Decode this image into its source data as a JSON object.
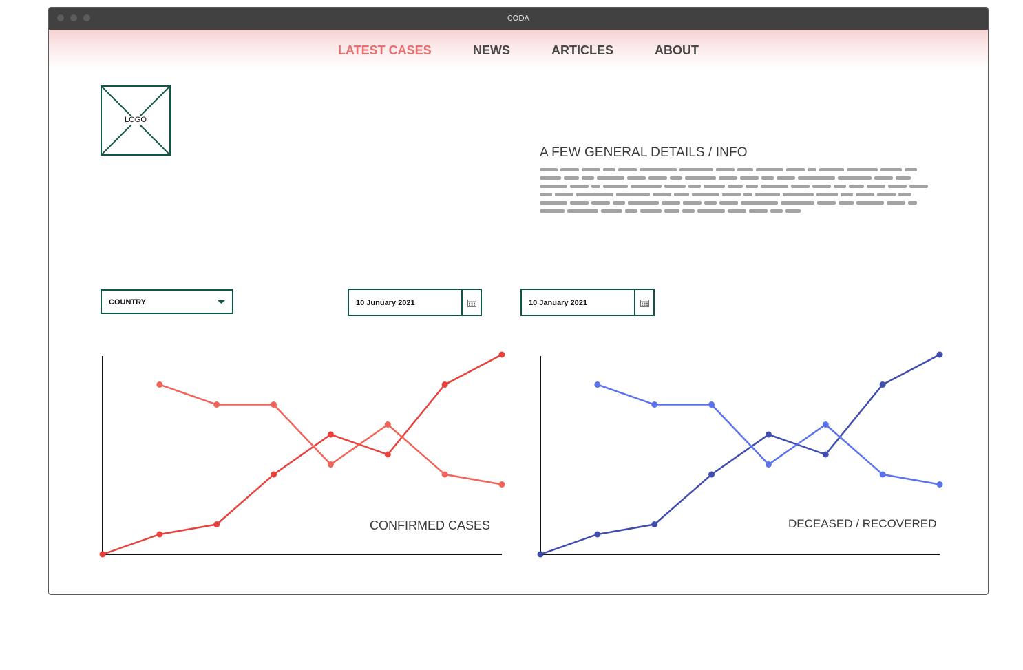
{
  "window": {
    "title": "CODA"
  },
  "nav": {
    "items": [
      {
        "label": "LATEST CASES",
        "active": true
      },
      {
        "label": "NEWS",
        "active": false
      },
      {
        "label": "ARTICLES",
        "active": false
      },
      {
        "label": "ABOUT",
        "active": false
      }
    ]
  },
  "logo": {
    "label": "LOGO"
  },
  "info": {
    "heading": "A FEW GENERAL DETAILS / INFO"
  },
  "filters": {
    "country": {
      "value": "COUNTRY"
    },
    "date_from": {
      "value": "10 Junuary 2021"
    },
    "date_to": {
      "value": "10 January 2021"
    }
  },
  "colors": {
    "accent": "#e86f6d",
    "border": "#115548",
    "red_dark": "#e8413c",
    "red_light": "#f2635a",
    "blue_dark": "#3f4daf",
    "blue_light": "#5a72ee"
  },
  "chart_data": [
    {
      "type": "line",
      "title": "CONFIRMED CASES",
      "x": [
        0,
        1,
        2,
        3,
        4,
        5,
        6,
        7
      ],
      "ylim": [
        0,
        10
      ],
      "series": [
        {
          "color": "#e8413c",
          "x": [
            0,
            1,
            2,
            3,
            4,
            5,
            6,
            7
          ],
          "values": [
            0,
            1,
            1.5,
            4,
            6,
            5,
            8.5,
            10
          ]
        },
        {
          "color": "#f2635a",
          "x": [
            1,
            2,
            3,
            4,
            5,
            6,
            7
          ],
          "values": [
            8.5,
            7.5,
            7.5,
            4.5,
            6.5,
            4,
            3.5
          ]
        }
      ]
    },
    {
      "type": "line",
      "title": "DECEASED / RECOVERED",
      "x": [
        0,
        1,
        2,
        3,
        4,
        5,
        6,
        7
      ],
      "ylim": [
        0,
        10
      ],
      "series": [
        {
          "color": "#3f4daf",
          "x": [
            0,
            1,
            2,
            3,
            4,
            5,
            6,
            7
          ],
          "values": [
            0,
            1,
            1.5,
            4,
            6,
            5,
            8.5,
            10
          ]
        },
        {
          "color": "#5a72ee",
          "x": [
            1,
            2,
            3,
            4,
            5,
            6,
            7
          ],
          "values": [
            8.5,
            7.5,
            7.5,
            4.5,
            6.5,
            4,
            3.5
          ]
        }
      ]
    }
  ]
}
